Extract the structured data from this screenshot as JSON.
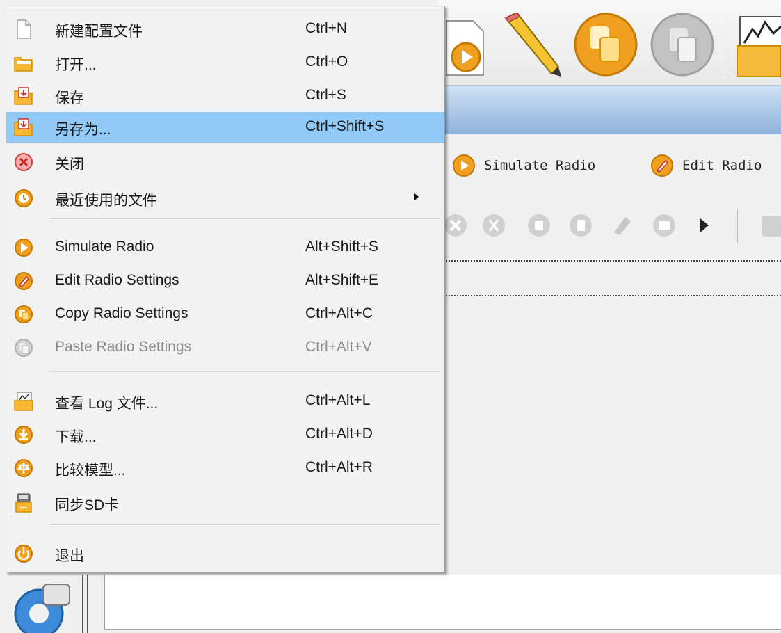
{
  "menu": {
    "items": [
      {
        "label": "新建配置文件",
        "shortcut": "Ctrl+N",
        "icon": "new-file-icon"
      },
      {
        "label": "打开...",
        "shortcut": "Ctrl+O",
        "icon": "open-folder-icon"
      },
      {
        "label": "保存",
        "shortcut": "Ctrl+S",
        "icon": "save-icon"
      },
      {
        "label": "另存为...",
        "shortcut": "Ctrl+Shift+S",
        "icon": "save-as-icon",
        "highlighted": true
      },
      {
        "label": "关闭",
        "shortcut": "",
        "icon": "close-icon"
      },
      {
        "label": "最近使用的文件",
        "shortcut": "",
        "icon": "recent-files-icon",
        "submenu": true
      },
      {
        "label": "Simulate Radio",
        "shortcut": "Alt+Shift+S",
        "icon": "simulate-icon"
      },
      {
        "label": "Edit Radio Settings",
        "shortcut": "Alt+Shift+E",
        "icon": "edit-icon"
      },
      {
        "label": "Copy Radio Settings",
        "shortcut": "Ctrl+Alt+C",
        "icon": "copy-icon"
      },
      {
        "label": "Paste Radio Settings",
        "shortcut": "Ctrl+Alt+V",
        "icon": "paste-icon",
        "disabled": true
      },
      {
        "label": "查看 Log 文件...",
        "shortcut": "Ctrl+Alt+L",
        "icon": "log-icon"
      },
      {
        "label": "下载...",
        "shortcut": "Ctrl+Alt+D",
        "icon": "download-icon"
      },
      {
        "label": "比较模型...",
        "shortcut": "Ctrl+Alt+R",
        "icon": "compare-icon"
      },
      {
        "label": "同步SD卡",
        "shortcut": "",
        "icon": "sd-card-icon"
      },
      {
        "label": "退出",
        "shortcut": "",
        "icon": "exit-icon"
      }
    ]
  },
  "radio_actions": {
    "simulate_label": "Simulate Radio",
    "edit_label": "Edit Radio"
  },
  "colors": {
    "highlight": "#91c9f7",
    "accent_orange": "#f0a020",
    "menu_bg": "#f2f2f2"
  }
}
